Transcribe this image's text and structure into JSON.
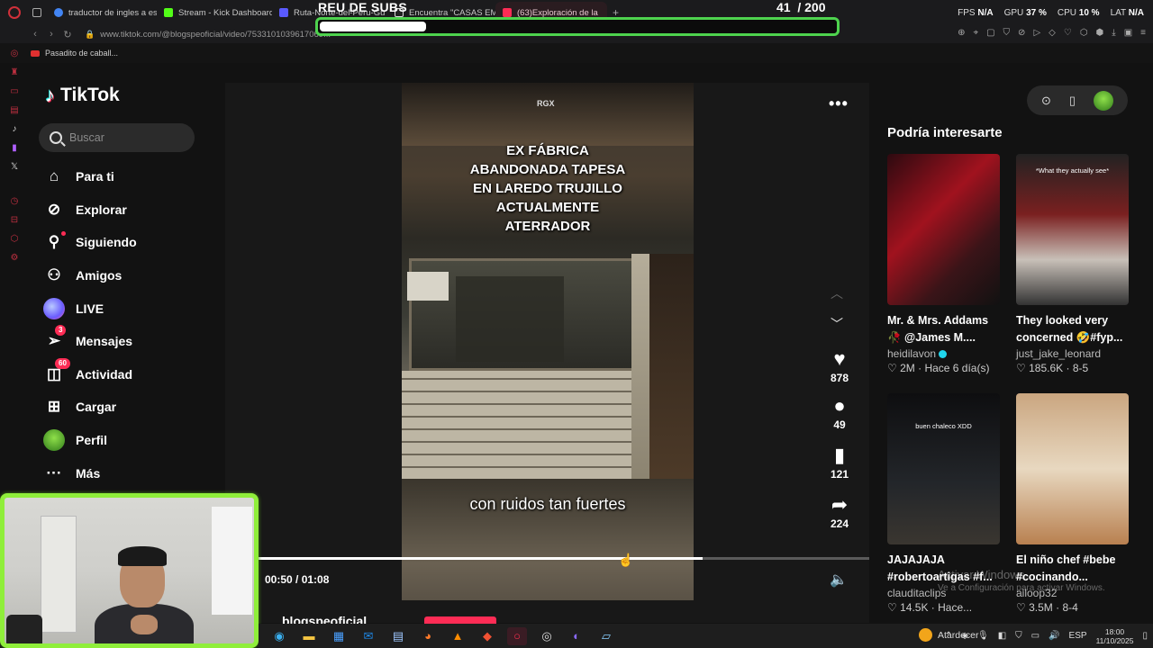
{
  "browser": {
    "tabs": [
      {
        "label": "traductor de ingles a espa",
        "icon": "google-icon",
        "color": "#4285f4"
      },
      {
        "label": "Stream - Kick Dashboard",
        "icon": "kick-icon",
        "color": "#53fc18"
      },
      {
        "label": "Ruta-Norte-del-Peru-Gu",
        "icon": "shield-icon",
        "color": "#5a5aff"
      },
      {
        "label": "Encuentra \"CASAS EMBR",
        "icon": "tiktok-icon",
        "color": "#ffffff"
      },
      {
        "label": "(63)Exploración de la",
        "icon": "tiktok-icon",
        "color": "#fe2c55",
        "active": true
      }
    ],
    "url": "www.tiktok.com/@blogspeoficial/video/7533101039617069...",
    "bookmark": "Pasadito de caball...",
    "stats": [
      {
        "label": "FPS",
        "value": "N/A"
      },
      {
        "label": "GPU",
        "value": "37 %"
      },
      {
        "label": "CPU",
        "value": "10 %"
      },
      {
        "label": "LAT",
        "value": "N/A"
      }
    ]
  },
  "overlay": {
    "goal_title": "REU DE SUBS",
    "goal_count": "41",
    "goal_total": "/ 200",
    "goal_progress": 0.205
  },
  "sidebar": {
    "logo": "TikTok",
    "search_placeholder": "Buscar",
    "items": [
      {
        "label": "Para ti",
        "icon": "home-icon"
      },
      {
        "label": "Explorar",
        "icon": "compass-icon"
      },
      {
        "label": "Siguiendo",
        "icon": "following-icon"
      },
      {
        "label": "Amigos",
        "icon": "friends-icon"
      },
      {
        "label": "LIVE",
        "icon": "live-icon"
      },
      {
        "label": "Mensajes",
        "icon": "messages-icon",
        "badge": "3"
      },
      {
        "label": "Actividad",
        "icon": "activity-icon",
        "badge": "60"
      },
      {
        "label": "Cargar",
        "icon": "upload-icon"
      },
      {
        "label": "Perfil",
        "icon": "avatar-icon"
      },
      {
        "label": "Más",
        "icon": "more-icon"
      }
    ]
  },
  "video": {
    "watermark": "RGX",
    "title_lines": [
      "EX FÁBRICA",
      "ABANDONADA TAPESA",
      "EN LAREDO TRUJILLO",
      "ACTUALMENTE",
      "ATERRADOR"
    ],
    "caption": "con ruidos tan fuertes",
    "likes": "878",
    "comments": "49",
    "saves": "121",
    "shares": "224",
    "time": "00:50 / 01:08",
    "progress": 0.727,
    "author": "blogspeoficial"
  },
  "recommendations": {
    "title": "Podría interesarte",
    "cards": [
      {
        "title1": "Mr. & Mrs. Addams",
        "title2": "🥀 @James M....",
        "user": "heidilavon",
        "verified": true,
        "likes": "2M",
        "age": "Hace 6 día(s)",
        "thumb_text": ""
      },
      {
        "title1": "They looked very",
        "title2": "concerned 🤣#fyp...",
        "user": "just_jake_leonard",
        "verified": false,
        "likes": "185.6K",
        "age": "8-5",
        "thumb_text": "*What they actually see*"
      },
      {
        "title1": "JAJAJAJA",
        "title2": "#robertoartigas #f...",
        "user": "clauditaclips",
        "verified": false,
        "likes": "14.5K",
        "age": "Hace...",
        "thumb_text": "buen chaleco XDD"
      },
      {
        "title1": "El niño chef #bebe",
        "title2": "#cocinando...",
        "user": "ailoop32",
        "verified": false,
        "likes": "3.5M",
        "age": "8-4",
        "thumb_text": ""
      }
    ]
  },
  "windows_watermark": {
    "line1": "Activar Windows",
    "line2": "Ve a Configuración para activar Windows."
  },
  "taskbar": {
    "weather": "Atardecer",
    "language": "ESP",
    "time": "18:00",
    "date": "11/10/2025"
  }
}
